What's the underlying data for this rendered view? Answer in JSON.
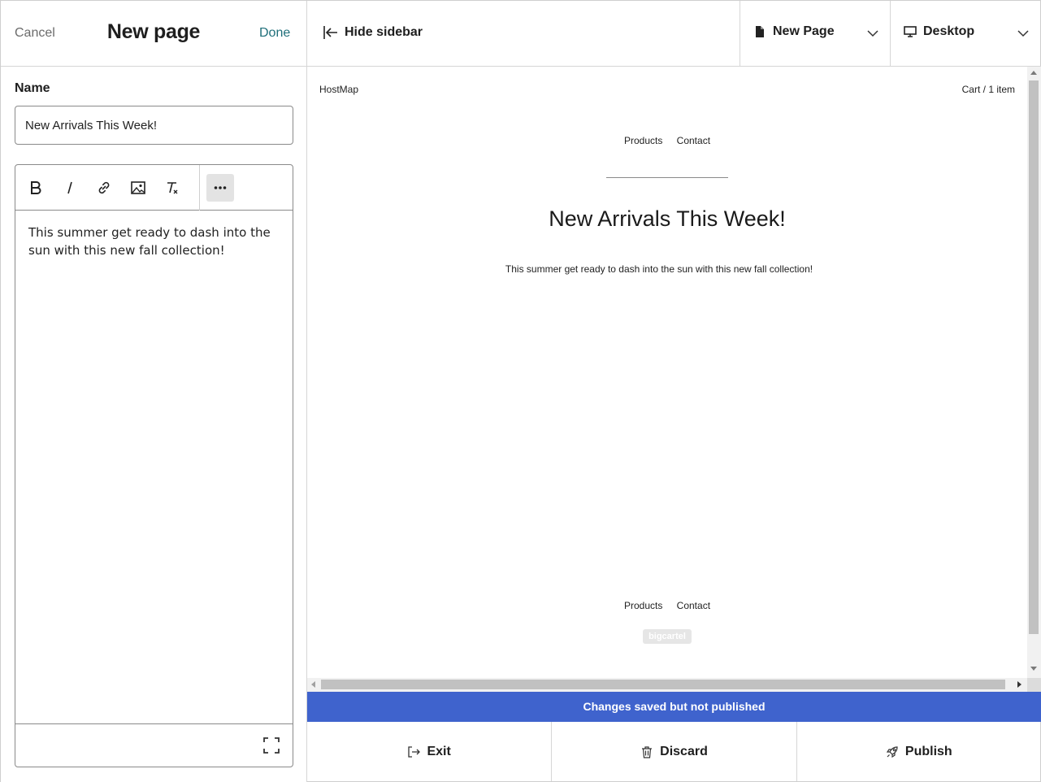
{
  "sidebar": {
    "cancel_label": "Cancel",
    "title": "New page",
    "done_label": "Done",
    "name_label": "Name",
    "name_value": "New Arrivals This Week!",
    "body_text": "This summer get ready to dash into the sun with this new fall collection!",
    "toolbar_icons": [
      "bold-icon",
      "italic-icon",
      "link-icon",
      "image-icon",
      "clear-format-icon",
      "more-icon"
    ]
  },
  "topbar": {
    "hide_sidebar_label": "Hide sidebar",
    "page_select_label": "New Page",
    "device_select_label": "Desktop"
  },
  "preview": {
    "brand": "HostMap",
    "cart": "Cart  / 1 item",
    "nav": [
      "Products",
      "Contact"
    ],
    "heading": "New Arrivals This Week!",
    "body": "This summer get ready to dash into the sun with this new fall collection!",
    "footer_nav": [
      "Products",
      "Contact"
    ],
    "badge": "bigcartel"
  },
  "status": {
    "message": "Changes saved but not published",
    "color": "#3f63cd"
  },
  "actions": {
    "exit_label": "Exit",
    "discard_label": "Discard",
    "publish_label": "Publish"
  }
}
